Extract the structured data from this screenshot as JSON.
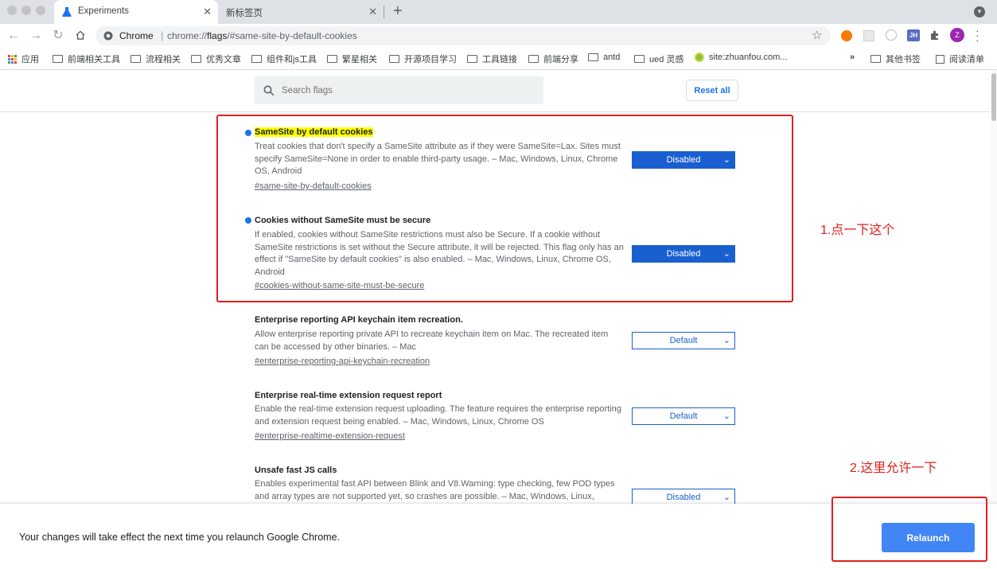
{
  "tabs": [
    {
      "title": "Experiments",
      "icon": "flask-icon"
    },
    {
      "title": "新标签页"
    }
  ],
  "toolbar": {
    "omnibox_site": "Chrome",
    "omnibox_url_prefix": "chrome://",
    "omnibox_url_bold": "flags",
    "omnibox_url_suffix": "/#same-site-by-default-cookies",
    "profile_initial": "Z",
    "ext_badge": "JH"
  },
  "bookmarks": [
    {
      "label": "应用",
      "icon": "apps-grid-icon"
    },
    {
      "label": "前端相关工具",
      "icon": "folder-icon"
    },
    {
      "label": "流程相关",
      "icon": "folder-icon"
    },
    {
      "label": "优秀文章",
      "icon": "folder-icon"
    },
    {
      "label": "组件和js工具",
      "icon": "folder-icon"
    },
    {
      "label": "繁星相关",
      "icon": "folder-icon"
    },
    {
      "label": "开源项目学习",
      "icon": "folder-icon"
    },
    {
      "label": "工具链接",
      "icon": "folder-icon"
    },
    {
      "label": "前端分享",
      "icon": "folder-icon"
    },
    {
      "label": "antd",
      "icon": "folder-icon"
    },
    {
      "label": "ued 灵感",
      "icon": "folder-icon"
    },
    {
      "label": "site:zhuanfou.com...",
      "icon": "globe-icon"
    }
  ],
  "bookmarks_more": "»",
  "other_bookmarks": "其他书签",
  "reading_list": "阅读清单",
  "search": {
    "placeholder": "Search flags"
  },
  "reset_label": "Reset all",
  "flags": [
    {
      "title": "SameSite by default cookies",
      "desc": "Treat cookies that don't specify a SameSite attribute as if they were SameSite=Lax. Sites must specify SameSite=None in order to enable third-party usage. – Mac, Windows, Linux, Chrome OS, Android",
      "link": "#same-site-by-default-cookies",
      "value": "Disabled",
      "modified": true,
      "highlighted": true
    },
    {
      "title": "Cookies without SameSite must be secure",
      "desc": "If enabled, cookies without SameSite restrictions must also be Secure. If a cookie without SameSite restrictions is set without the Secure attribute, it will be rejected. This flag only has an effect if \"SameSite by default cookies\" is also enabled. – Mac, Windows, Linux, Chrome OS, Android",
      "link": "#cookies-without-same-site-must-be-secure",
      "value": "Disabled",
      "modified": true
    },
    {
      "title": "Enterprise reporting API keychain item recreation.",
      "desc": "Allow enterprise reporting private API to recreate keychain item on Mac. The recreated item can be accessed by other binaries. – Mac",
      "link": "#enterprise-reporting-api-keychain-recreation",
      "value": "Default",
      "modified": false
    },
    {
      "title": "Enterprise real-time extension request report",
      "desc": "Enable the real-time extension request uploading. The feature requires the enterprise reporting and extension request being enabled. – Mac, Windows, Linux, Chrome OS",
      "link": "#enterprise-realtime-extension-request",
      "value": "Default",
      "modified": false
    },
    {
      "title": "Unsafe fast JS calls",
      "desc": "Enables experimental fast API between Blink and V8.Warning: type checking, few POD types and array types are not supported yet, so crashes are possible. – Mac, Windows, Linux,",
      "link": "",
      "value": "Disabled",
      "modified": false
    }
  ],
  "annotations": {
    "note1": "1.点一下这个",
    "note2": "2.这里允许一下"
  },
  "bottom": {
    "message": "Your changes will take effect the next time you relaunch Google Chrome.",
    "relaunch_label": "Relaunch"
  },
  "colors": {
    "accent": "#1a5fd0",
    "relaunch": "#4285f4",
    "annotation": "#e02020",
    "highlight": "#ffff00"
  }
}
